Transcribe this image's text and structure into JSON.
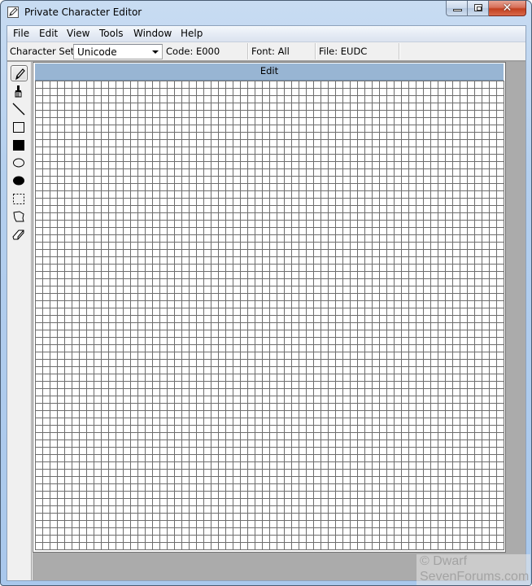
{
  "window": {
    "title": "Private Character Editor",
    "icon": "pencil-app-icon",
    "caption_buttons": {
      "minimize": "minimize",
      "maximize": "restore",
      "close": "close"
    }
  },
  "menubar": {
    "items": [
      {
        "label": "File"
      },
      {
        "label": "Edit"
      },
      {
        "label": "View"
      },
      {
        "label": "Tools"
      },
      {
        "label": "Window"
      },
      {
        "label": "Help"
      }
    ]
  },
  "toolbar": {
    "charset_label": "Character Set:",
    "charset_value": "Unicode",
    "code": "Code: E000",
    "font": "Font: All",
    "file": "File: EUDC"
  },
  "tools": [
    {
      "name": "pencil",
      "icon": "pencil-icon",
      "active": true
    },
    {
      "name": "brush",
      "icon": "brush-icon",
      "active": false
    },
    {
      "name": "straight-line",
      "icon": "line-icon",
      "active": false
    },
    {
      "name": "hollow-rectangle",
      "icon": "hollow-rectangle-icon",
      "active": false
    },
    {
      "name": "filled-rectangle",
      "icon": "filled-rectangle-icon",
      "active": false
    },
    {
      "name": "hollow-ellipse",
      "icon": "hollow-ellipse-icon",
      "active": false
    },
    {
      "name": "filled-ellipse",
      "icon": "filled-ellipse-icon",
      "active": false
    },
    {
      "name": "rectangular-selection",
      "icon": "rect-select-icon",
      "active": false
    },
    {
      "name": "freeform-selection",
      "icon": "freeform-select-icon",
      "active": false
    },
    {
      "name": "eraser",
      "icon": "eraser-icon",
      "active": false
    }
  ],
  "edit_window": {
    "title": "Edit",
    "grid": {
      "columns": 64,
      "rows": 64
    }
  },
  "colors": {
    "edit_header": "#98b5d3",
    "mdi_background": "#ababab",
    "grid_line": "#6e6e6e"
  },
  "watermark": {
    "line1": "© Dwarf",
    "line2": "SevenForums.com"
  }
}
